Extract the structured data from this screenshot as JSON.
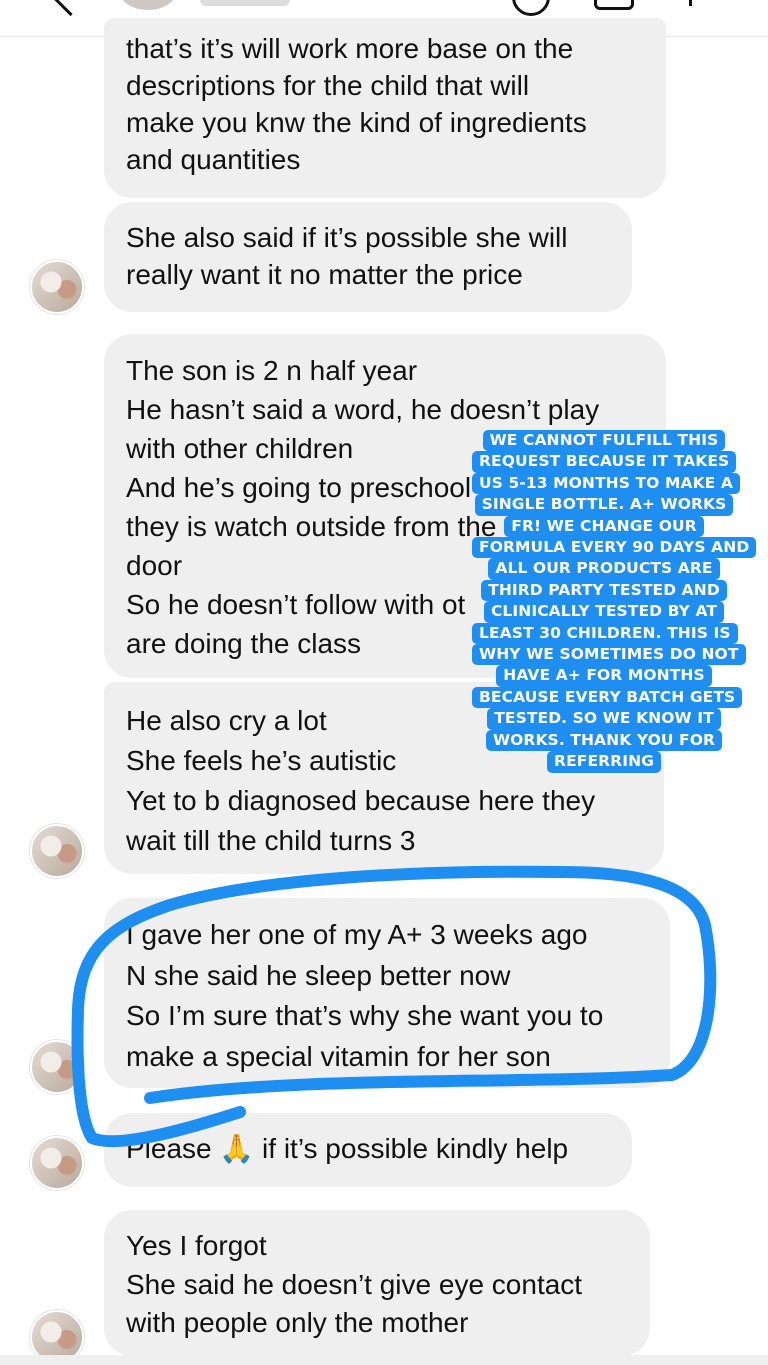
{
  "messages": [
    {
      "lines": [
        "that’s it’s will work more base on the",
        "descriptions for the child that will",
        "make you knw the kind of ingredients",
        "and quantities"
      ]
    },
    {
      "lines": [
        "She also said if it’s possible she will",
        "really want it no matter the price"
      ]
    },
    {
      "lines": [
        "The son is 2 n half year",
        "He hasn’t said a word, he doesn’t play",
        "with other children",
        "And he’s going to preschool",
        "they is watch outside from the",
        "door",
        "So he doesn’t follow with ot",
        "are doing the class"
      ]
    },
    {
      "lines": [
        "He also cry a lot",
        "She feels he’s autistic",
        "Yet to b diagnosed because here they",
        "wait till the child turns 3"
      ]
    },
    {
      "lines": [
        "I gave her one of my A+ 3 weeks ago",
        "N she said he sleep better now",
        "So I’m sure that’s why she want you to",
        "make a special vitamin for her son"
      ]
    },
    {
      "lines": [
        "Please 🙏 if it’s possible kindly help"
      ]
    },
    {
      "lines": [
        "Yes I forgot",
        "She said he doesn’t give eye contact",
        "with people only the mother"
      ]
    }
  ],
  "overlay": {
    "lines": [
      "WE CANNOT FULFILL THIS",
      "REQUEST BECAUSE IT TAKES",
      "US 5-13 MONTHS TO MAKE A",
      "SINGLE BOTTLE. A+ WORKS",
      "FR! WE CHANGE OUR",
      "FORMULA EVERY 90 DAYS AND",
      "ALL OUR PRODUCTS ARE",
      "THIRD PARTY TESTED AND",
      "CLINICALLY TESTED BY AT",
      "LEAST 30 CHILDREN. THIS IS",
      "WHY WE SOMETIMES DO NOT",
      "HAVE A+ FOR MONTHS",
      "BECAUSE EVERY BATCH GETS",
      "TESTED. SO WE KNOW IT",
      "WORKS. THANK YOU FOR",
      "REFERRING"
    ],
    "background": "#1e8ff0",
    "text_color": "#ffffff"
  },
  "colors": {
    "bubble": "#efefef",
    "annotation_stroke": "#1e8ff0"
  }
}
